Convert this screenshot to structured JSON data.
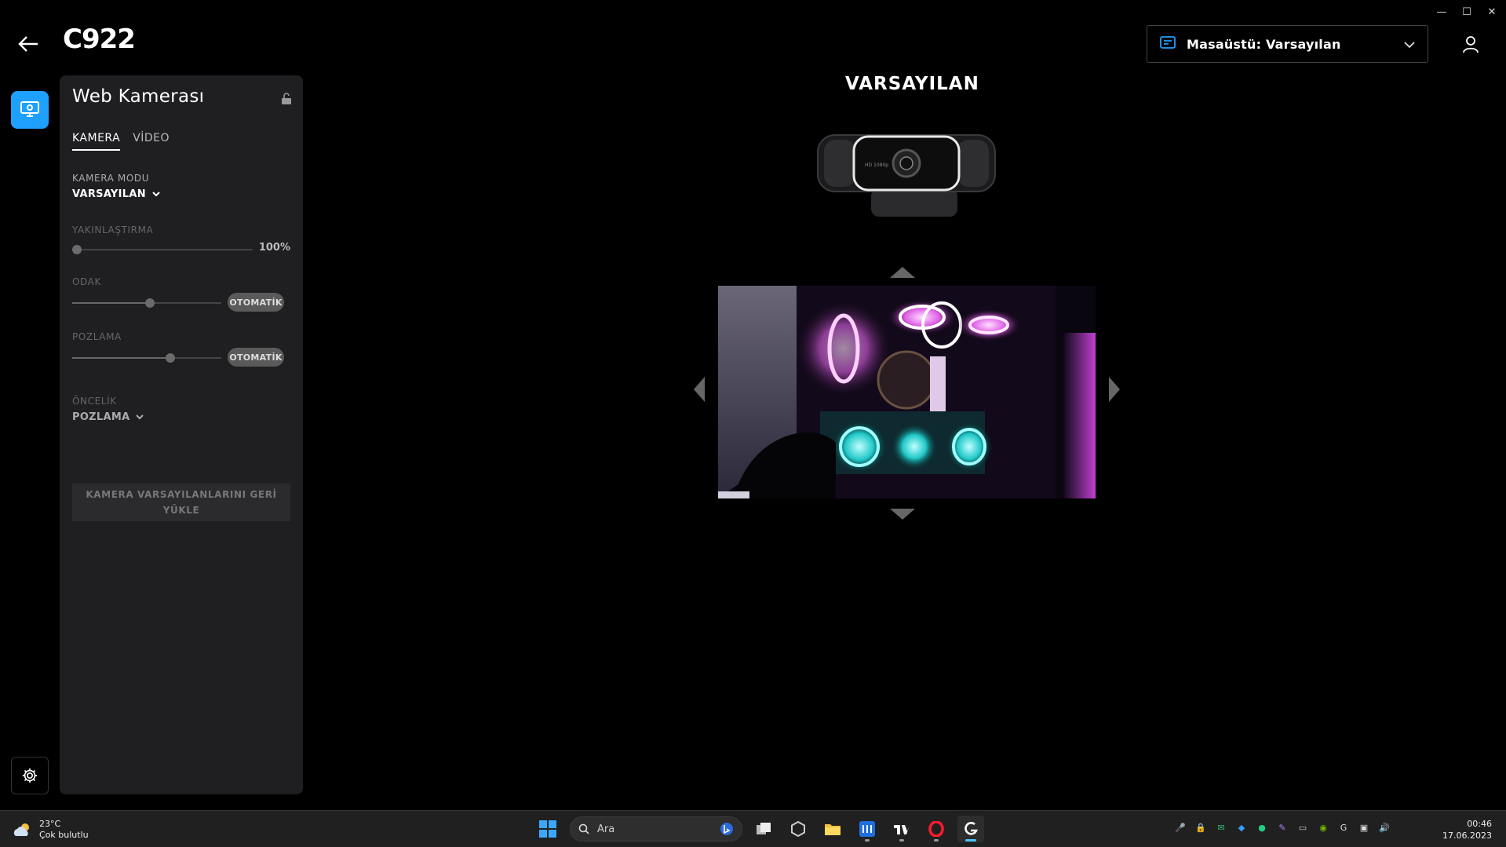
{
  "window": {
    "minimize_glyph": "—",
    "maximize_glyph": "☐",
    "close_glyph": "✕"
  },
  "header": {
    "title": "C922",
    "profile": "Masaüstü: Varsayılan"
  },
  "panel": {
    "title": "Web Kamerası",
    "tabs": [
      "KAMERA",
      "VİDEO"
    ],
    "active_tab": "KAMERA",
    "camera_mode": {
      "label": "KAMERA MODU",
      "value": "VARSAYILAN"
    },
    "zoom": {
      "label": "YAKINLAŞTIRMA",
      "value_text": "100%",
      "position": 0.02
    },
    "focus": {
      "label": "ODAK",
      "auto_label": "OTOMATİK",
      "position": 0.52
    },
    "exposure": {
      "label": "POZLAMA",
      "auto_label": "OTOMATİK",
      "position": 0.66
    },
    "priority": {
      "label": "ÖNCELİK",
      "value": "POZLAMA"
    },
    "reset_button": "KAMERA VARSAYILANLARINI GERİ YÜKLE"
  },
  "main": {
    "title": "VARSAYILAN"
  },
  "taskbar": {
    "weather_temp": "23°C",
    "weather_desc": "Çok bulutlu",
    "search_placeholder": "Ara",
    "time": "00:46",
    "date": "17.06.2023"
  },
  "colors": {
    "accent": "#1ea0ff",
    "panel_bg": "#1f1f22",
    "background": "#000000"
  }
}
